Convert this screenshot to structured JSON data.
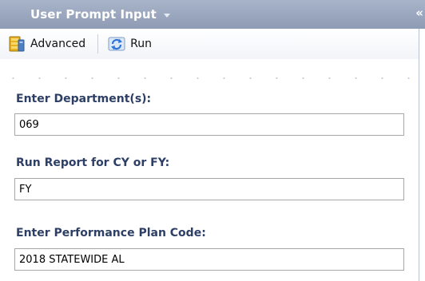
{
  "panel": {
    "title": "User Prompt Input",
    "collapse_glyph": "«"
  },
  "toolbar": {
    "advanced_label": "Advanced",
    "run_label": "Run"
  },
  "icons": {
    "advanced": "database-icon",
    "run": "refresh-icon"
  },
  "fields": [
    {
      "label": "Enter Department(s):",
      "value": "069"
    },
    {
      "label": "Run Report for CY or FY:",
      "value": "FY"
    },
    {
      "label": "Enter  Performance Plan Code:",
      "value": "2018 STATEWIDE AL"
    }
  ]
}
